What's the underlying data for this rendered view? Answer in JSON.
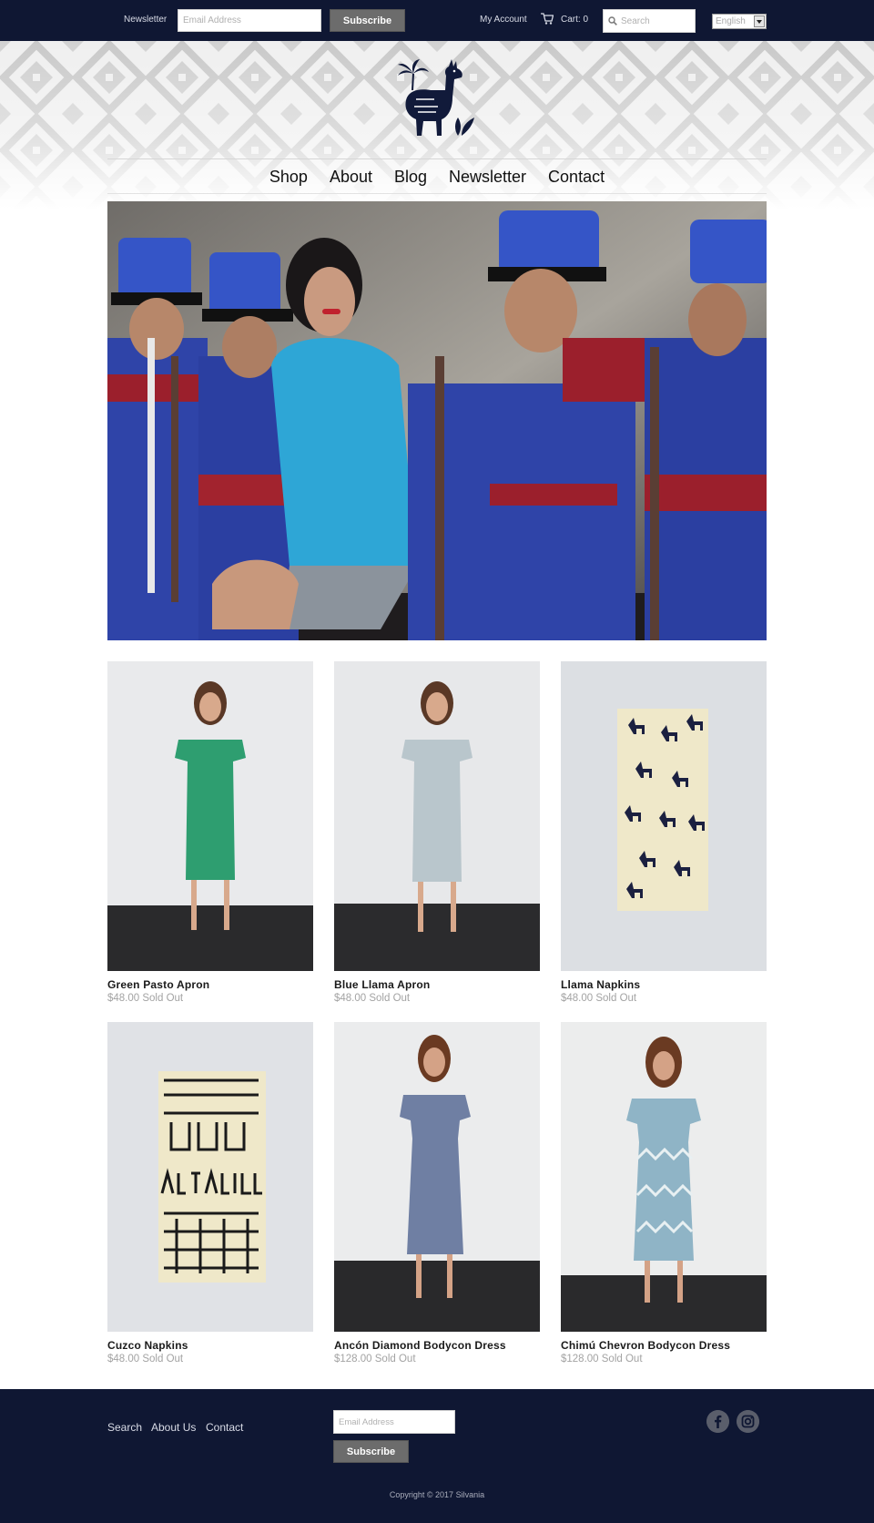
{
  "topbar": {
    "newsletter_label": "Newsletter",
    "email_placeholder": "Email Address",
    "subscribe_label": "Subscribe",
    "account_label": "My Account",
    "cart_label": "Cart: 0",
    "search_placeholder": "Search",
    "language_selected": "English"
  },
  "nav": {
    "items": [
      {
        "label": "Shop"
      },
      {
        "label": "About"
      },
      {
        "label": "Blog"
      },
      {
        "label": "Newsletter"
      },
      {
        "label": "Contact"
      }
    ]
  },
  "products": [
    {
      "name": "Green Pasto Apron",
      "meta": "$48.00 Sold Out",
      "image": "model-dress-green",
      "color": "#2e9e70"
    },
    {
      "name": "Blue Llama Apron",
      "meta": "$48.00 Sold Out",
      "image": "model-dress-pale",
      "color": "#b9c6cc"
    },
    {
      "name": "Llama Napkins",
      "meta": "$48.00 Sold Out",
      "image": "folded-napkin-llama",
      "color": "#efe8c9"
    },
    {
      "name": "Cuzco Napkins",
      "meta": "$48.00 Sold Out",
      "image": "folded-napkin-cuzco",
      "color": "#efe8c9"
    },
    {
      "name": "Ancón Diamond Bodycon Dress",
      "meta": "$128.00 Sold Out",
      "image": "model-dress-diamond",
      "color": "#6f7fa3"
    },
    {
      "name": "Chimú Chevron Bodycon Dress",
      "meta": "$128.00 Sold Out",
      "image": "model-dress-chevron",
      "color": "#8fb4c6"
    }
  ],
  "footer": {
    "links": [
      {
        "label": "Search"
      },
      {
        "label": "About Us"
      },
      {
        "label": "Contact"
      }
    ],
    "email_placeholder": "Email Address",
    "subscribe_label": "Subscribe",
    "social": [
      "facebook-icon",
      "instagram-icon"
    ],
    "copyright": "Copyright © 2017 Silvania"
  },
  "colors": {
    "navy": "#0f1733",
    "button_gray": "#6c6c6c",
    "price_gray": "#a3a3a3"
  }
}
